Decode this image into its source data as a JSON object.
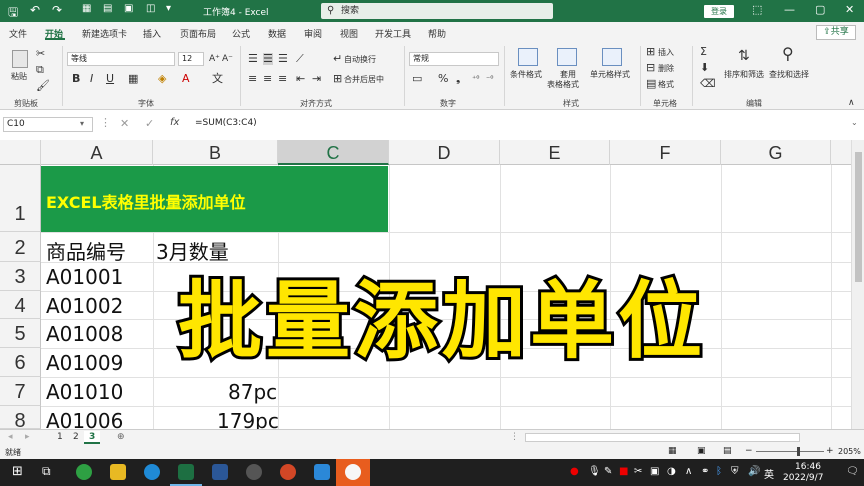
{
  "titlebar": {
    "doc_title": "工作簿4 - Excel",
    "search_placeholder": "搜索",
    "login": "登录",
    "minimize": "—",
    "maximize": "▢",
    "close": "✕"
  },
  "menu": {
    "tabs": [
      "文件",
      "开始",
      "新建选项卡",
      "插入",
      "页面布局",
      "公式",
      "数据",
      "审阅",
      "视图",
      "开发工具",
      "帮助"
    ],
    "share": "共享"
  },
  "ribbon": {
    "paste": "粘贴",
    "groups": [
      "剪贴板",
      "字体",
      "对齐方式",
      "数字",
      "样式",
      "单元格",
      "编辑"
    ],
    "font_name": "等线",
    "font_size": "12",
    "wrap_text": "自动换行",
    "merge_center": "合并后居中",
    "number_format": "常规",
    "cond_format": "条件格式",
    "table_format_1": "套用",
    "table_format_2": "表格格式",
    "cell_styles": "单元格样式",
    "insert": "插入",
    "delete": "删除",
    "format": "格式",
    "sort_filter": "排序和筛选",
    "find_select": "查找和选择"
  },
  "formula_bar": {
    "name_box": "C10",
    "fx": "fx",
    "formula": "=SUM(C3:C4)"
  },
  "grid": {
    "columns": [
      "A",
      "B",
      "C",
      "D",
      "E",
      "F",
      "G"
    ],
    "rows": [
      "1",
      "2",
      "3",
      "4",
      "5",
      "6",
      "7",
      "8"
    ],
    "banner": "EXCEL表格里批量添加单位",
    "header_a": "商品编号",
    "header_b": "3月数量",
    "cells_a": [
      "A01001",
      "A01002",
      "A01008",
      "A01009",
      "A01010",
      "A01006"
    ],
    "cells_b": [
      "",
      "",
      "",
      "",
      "87pc",
      "179pc"
    ]
  },
  "overlay_text": "批量添加单位",
  "sheets": {
    "tabs": [
      "1",
      "2",
      "3"
    ],
    "add": "⊕"
  },
  "status": {
    "ready": "就绪",
    "zoom": "205%"
  },
  "taskbar": {
    "time": "16:46",
    "date": "2022/9/7",
    "ime": "英"
  }
}
